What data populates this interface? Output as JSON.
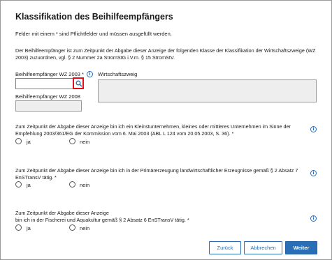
{
  "dialog": {
    "title": "Klassifikation des Beihilfeempfängers",
    "required_hint": "Felder mit einem * sind Pflichtfelder und müssen ausgefüllt werden.",
    "intro": "Der Beihilfeempfänger ist zum Zeitpunkt der Abgabe dieser Anzeige der folgenden Klasse der Klassifikation der Wirtschaftszweige (WZ 2003) zuzuordnen, vgl. § 2 Nummer 2a StromStG i.V.m. § 15 StromStV."
  },
  "fields": {
    "wz2003_label": "Beihilfeempfänger WZ 2003 *",
    "wz2003_value": "",
    "wirtschaftszweig_label": "Wirtschaftszweig",
    "wirtschaftszweig_value": "",
    "wz2008_label": "Beihilfeempfänger WZ 2008",
    "wz2008_value": ""
  },
  "questions": [
    {
      "text": "Zum Zeitpunkt der Abgabe dieser Anzeige bin ich ein Kleinstunternehmen, kleines oder mittleres Unternehmen im Sinne der Empfehlung 2003/361/EG der Kommission vom 6. Mai 2003 (ABL L 124 vom 20.05.2003, S. 36). *",
      "yes": "ja",
      "no": "nein"
    },
    {
      "text": "Zum Zeitpunkt der Abgabe dieser Anzeige bin ich in der Primärerzeugung landwirtschaftlicher Erzeugnisse gemäß § 2 Absatz 7 EnSTransV tätig. *",
      "yes": "ja",
      "no": "nein"
    },
    {
      "text": "Zum Zeitpunkt der Abgabe dieser Anzeige\nbin ich in der Fischerei und Aquakultur gemäß § 2 Absatz 6 EnSTransV tätig. *",
      "yes": "ja",
      "no": "nein"
    }
  ],
  "buttons": {
    "back": "Zurück",
    "cancel": "Abbrechen",
    "next": "Weiter"
  },
  "icons": {
    "info": "info-icon",
    "search": "search-icon"
  },
  "colors": {
    "accent": "#2a6fb5",
    "highlight": "#e0101c"
  }
}
